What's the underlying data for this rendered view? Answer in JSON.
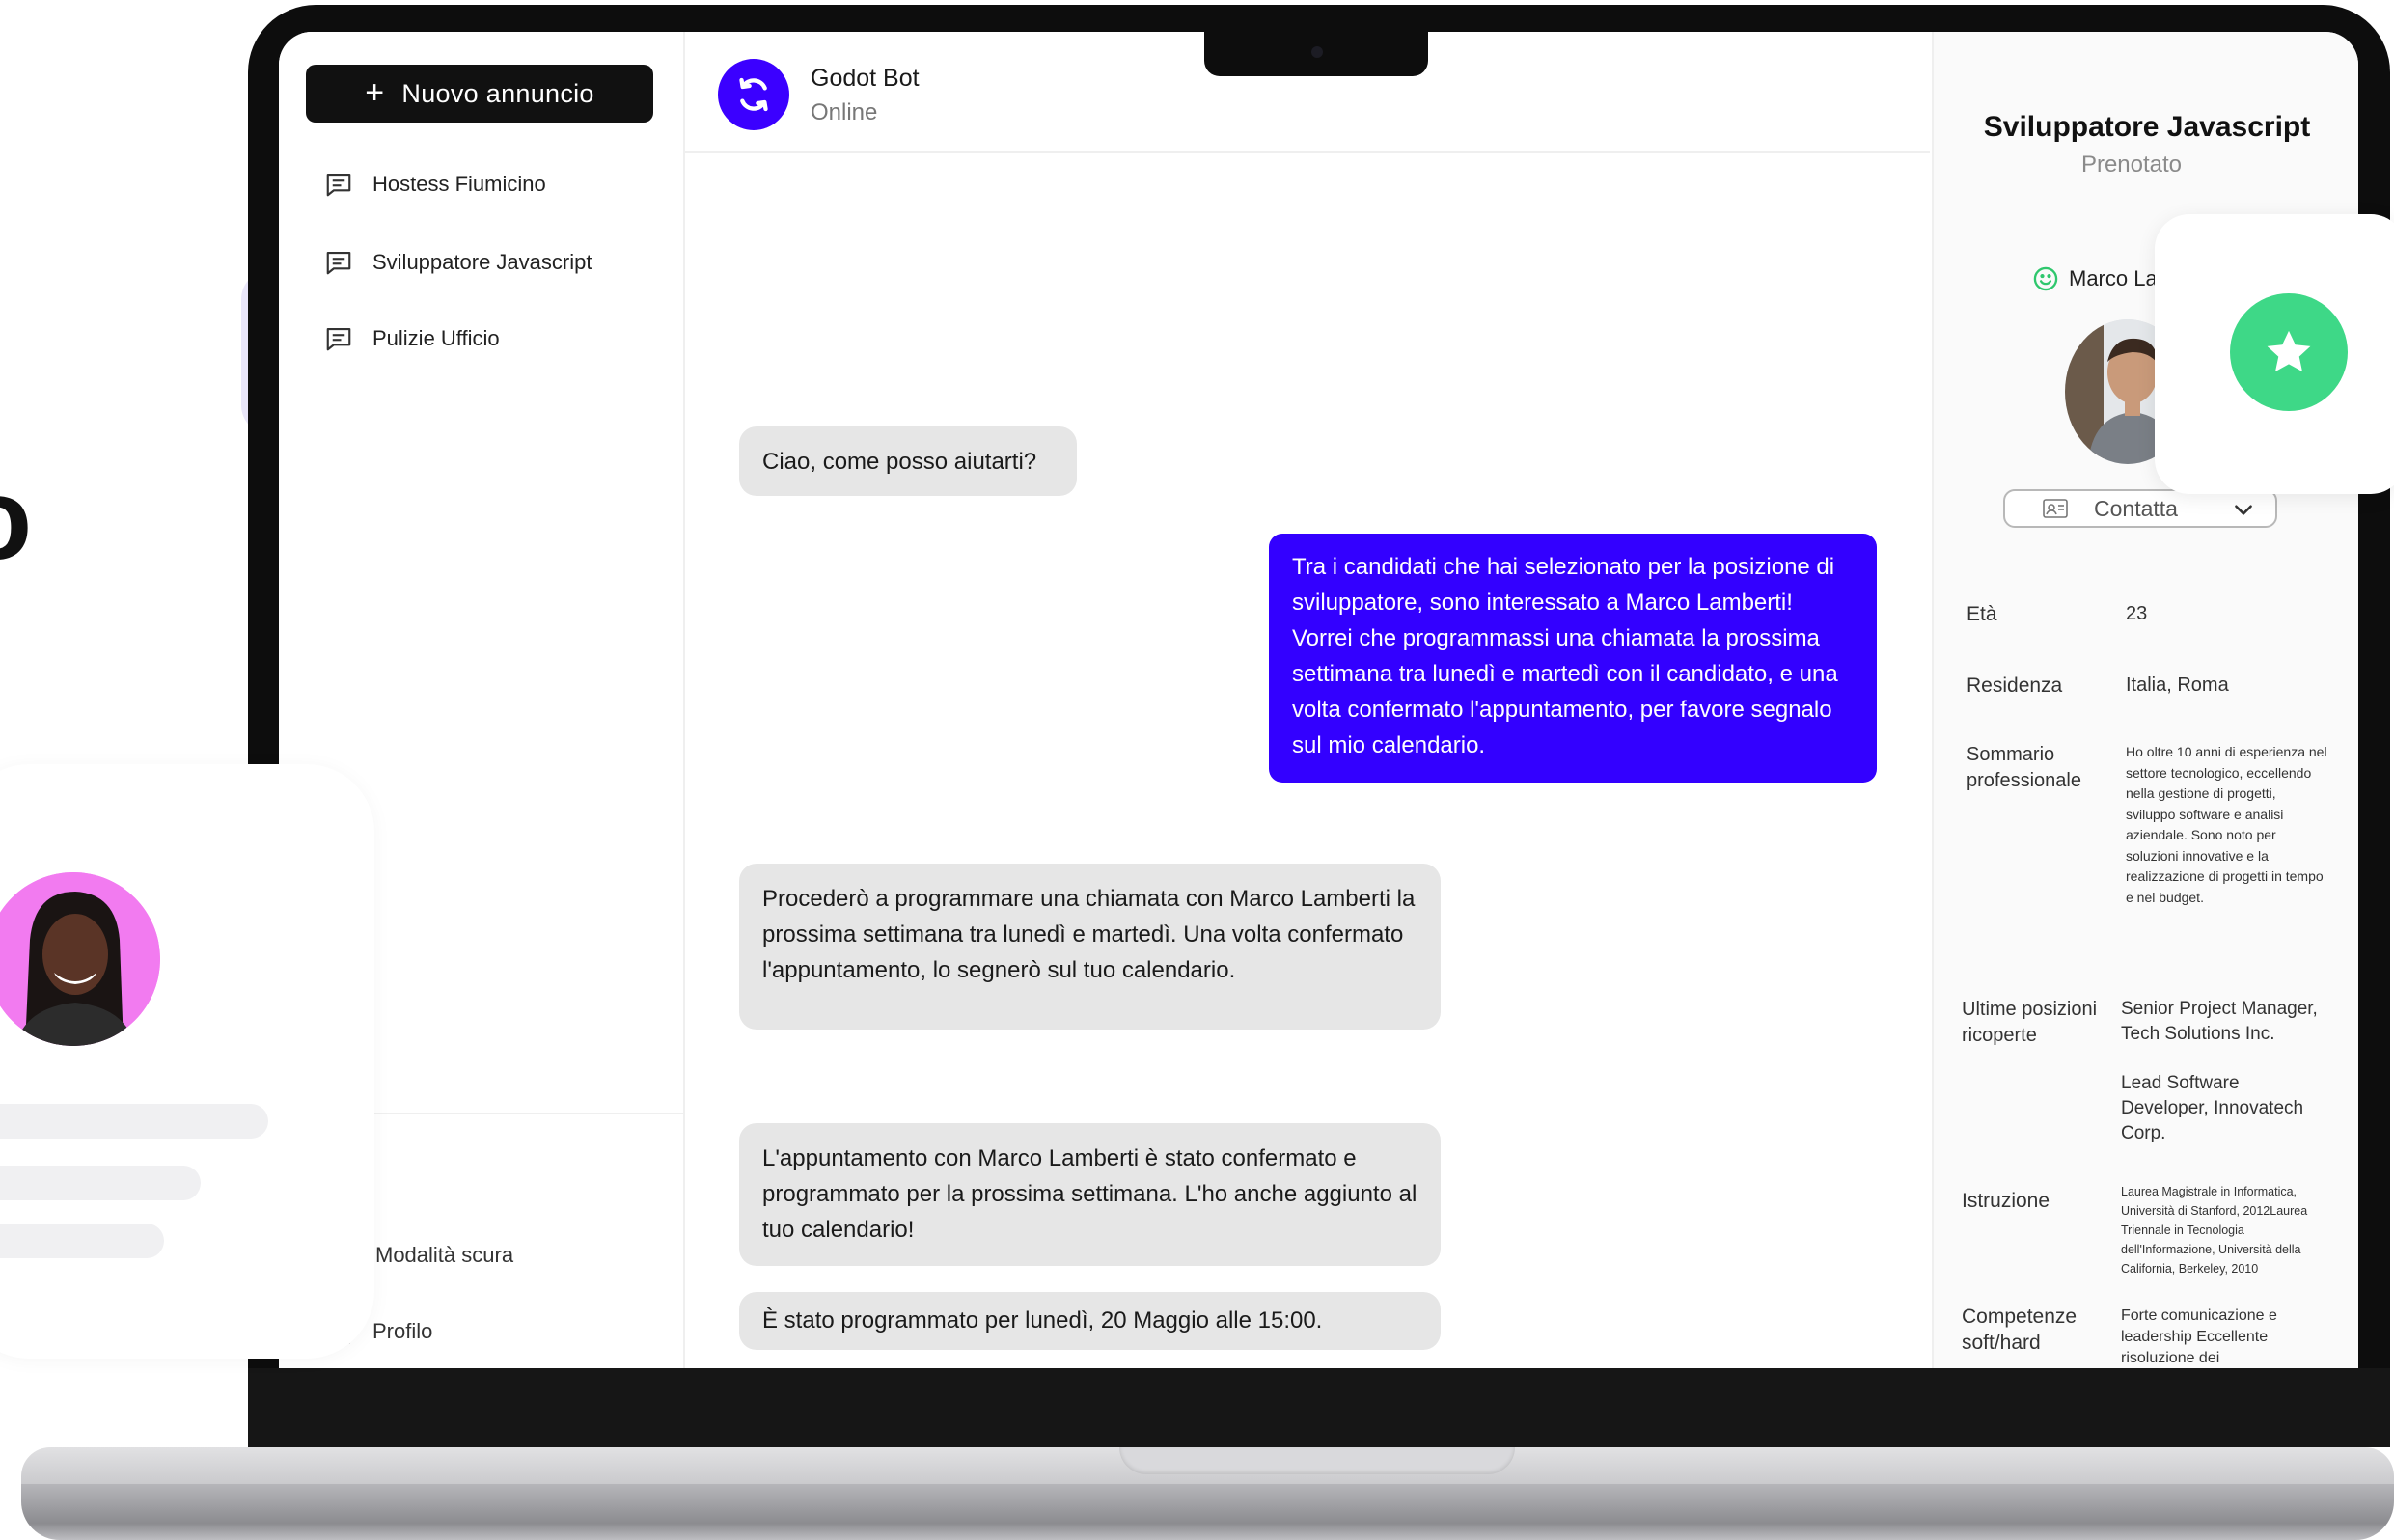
{
  "sidebar": {
    "new_button": "Nuovo annuncio",
    "items": [
      {
        "label": "Hostess Fiumicino"
      },
      {
        "label": "Sviluppatore Javascript"
      },
      {
        "label": "Pulizie Ufficio"
      }
    ],
    "dark_mode": "Modalità scura",
    "profile": "Profilo"
  },
  "chat": {
    "bot_name": "Godot Bot",
    "bot_status": "Online",
    "messages": [
      {
        "from": "bot",
        "text": "Ciao, come posso aiutarti?"
      },
      {
        "from": "user",
        "text": "Tra i candidati che hai selezionato per la posizione di sviluppatore, sono interessato a Marco Lamberti! Vorrei che programmassi una chiamata la prossima settimana tra lunedì e martedì con il candidato, e una volta confermato l'appuntamento, per favore segnalo sul mio calendario."
      },
      {
        "from": "bot",
        "text": "Procederò a programmare una chiamata con Marco Lamberti la prossima settimana tra lunedì e martedì. Una volta confermato l'appuntamento, lo segnerò sul tuo calendario."
      },
      {
        "from": "bot",
        "text": "L'appuntamento con Marco Lamberti è stato confermato e programmato per la prossima settimana. L'ho anche aggiunto al tuo calendario!"
      },
      {
        "from": "bot",
        "text": "È stato programmato per lunedì, 20 Maggio alle 15:00."
      }
    ]
  },
  "detail": {
    "title": "Sviluppatore Javascript",
    "status": "Prenotato",
    "candidate_name": "Marco La",
    "contact_label": "Contatta",
    "fields": {
      "age_label": "Età",
      "age_value": "23",
      "residence_label": "Residenza",
      "residence_value": "Italia, Roma",
      "summary_label": "Sommario professionale",
      "summary_value": "Ho oltre 10 anni di esperienza nel settore tecnologico, eccellendo nella gestione di progetti, sviluppo software e analisi aziendale. Sono noto per soluzioni innovative e la realizzazione di progetti in tempo e nel budget.",
      "positions_label": "Ultime posizioni ricoperte",
      "position_1": "Senior Project Manager, Tech Solutions Inc.",
      "position_2": "Lead Software Developer, Innovatech Corp.",
      "education_label": "Istruzione",
      "education_value": "Laurea Magistrale in Informatica, Università di Stanford, 2012Laurea Triennale in Tecnologia dell'Informazione, Università della California, Berkeley, 2010",
      "skills_label": "Competenze soft/hard",
      "skills_value": "Forte comunicazione e leadership Eccellente risoluzione dei"
    }
  },
  "decor": {
    "big_letter": "o"
  },
  "colors": {
    "accent": "#3300ff",
    "bot_avatar": "#3b00ff",
    "star": "#3ed887",
    "profile_avatar_bg": "#f27bf0"
  },
  "icons": [
    "plus-icon",
    "chat-icon",
    "sync-icon",
    "smile-icon",
    "contact-card-icon",
    "chevron-down-icon",
    "star-icon",
    "user-icon"
  ]
}
